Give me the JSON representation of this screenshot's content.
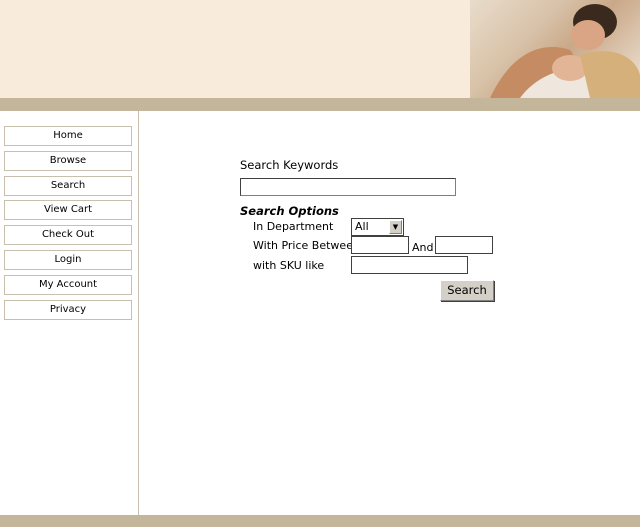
{
  "nav": {
    "items": [
      {
        "label": "Home"
      },
      {
        "label": "Browse"
      },
      {
        "label": "Search"
      },
      {
        "label": "View Cart"
      },
      {
        "label": "Check Out"
      },
      {
        "label": "Login"
      },
      {
        "label": "My Account"
      },
      {
        "label": "Privacy"
      }
    ]
  },
  "search": {
    "keywords_label": "Search Keywords",
    "keywords_value": "",
    "options_title": "Search Options",
    "department_label": "In Department",
    "department_value": "All",
    "price_label": "With Price Between",
    "price_from": "",
    "and_label": "And",
    "price_to": "",
    "sku_label": "with SKU like",
    "sku_value": "",
    "button_label": "Search"
  },
  "colors": {
    "header_bg": "#f8ebdc",
    "band": "#c4b69a"
  }
}
